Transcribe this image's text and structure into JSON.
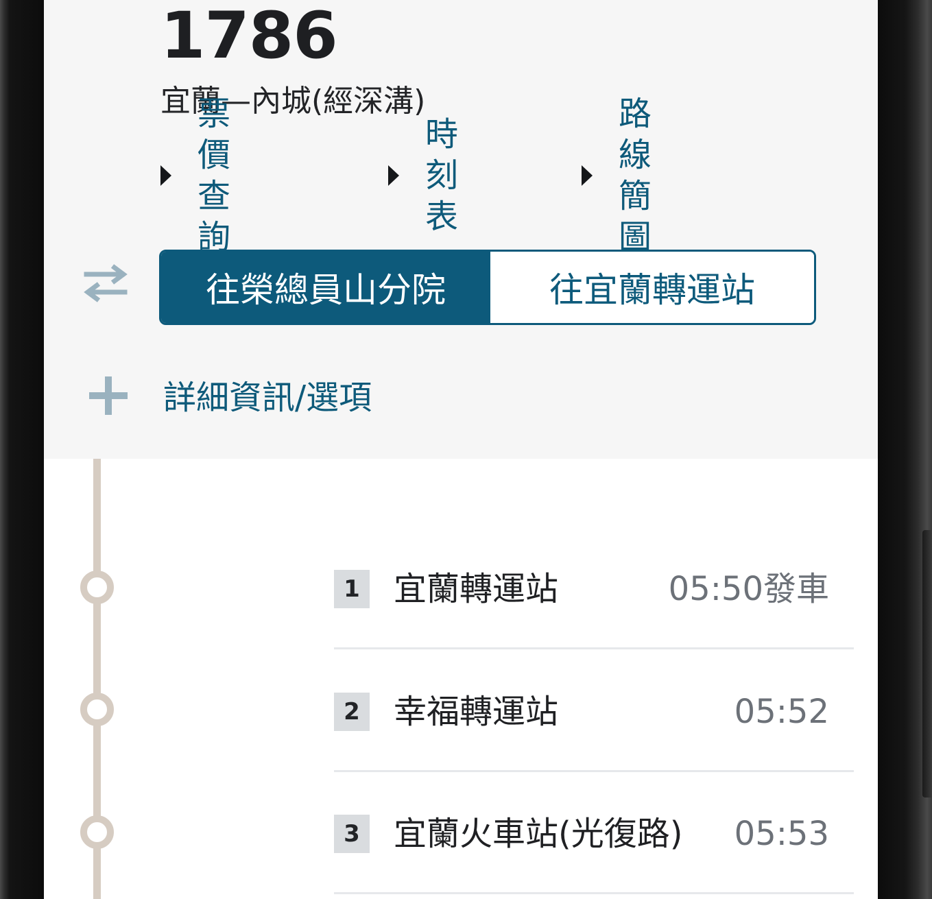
{
  "route": {
    "number": "1786",
    "name": "宜蘭—內城(經深溝)"
  },
  "links": [
    {
      "label": "票價查詢"
    },
    {
      "label": "時刻表"
    },
    {
      "label": "路線簡圖"
    }
  ],
  "direction_toggle": {
    "options": [
      {
        "label": "往榮總員山分院",
        "selected": true
      },
      {
        "label": "往宜蘭轉運站",
        "selected": false
      }
    ]
  },
  "icons": {
    "swap": "swap-arrows-icon",
    "expand": "plus-icon"
  },
  "details_link": "詳細資訊/選項",
  "stops": [
    {
      "seq": "1",
      "name": "宜蘭轉運站",
      "time": "05:50發車"
    },
    {
      "seq": "2",
      "name": "幸福轉運站",
      "time": "05:52"
    },
    {
      "seq": "3",
      "name": "宜蘭火車站(光復路)",
      "time": "05:53"
    }
  ],
  "colors": {
    "primary": "#0d5a7b",
    "link": "#0e5a7a",
    "timeline": "#d6ccc2",
    "header_bg": "#f6f6f6"
  }
}
